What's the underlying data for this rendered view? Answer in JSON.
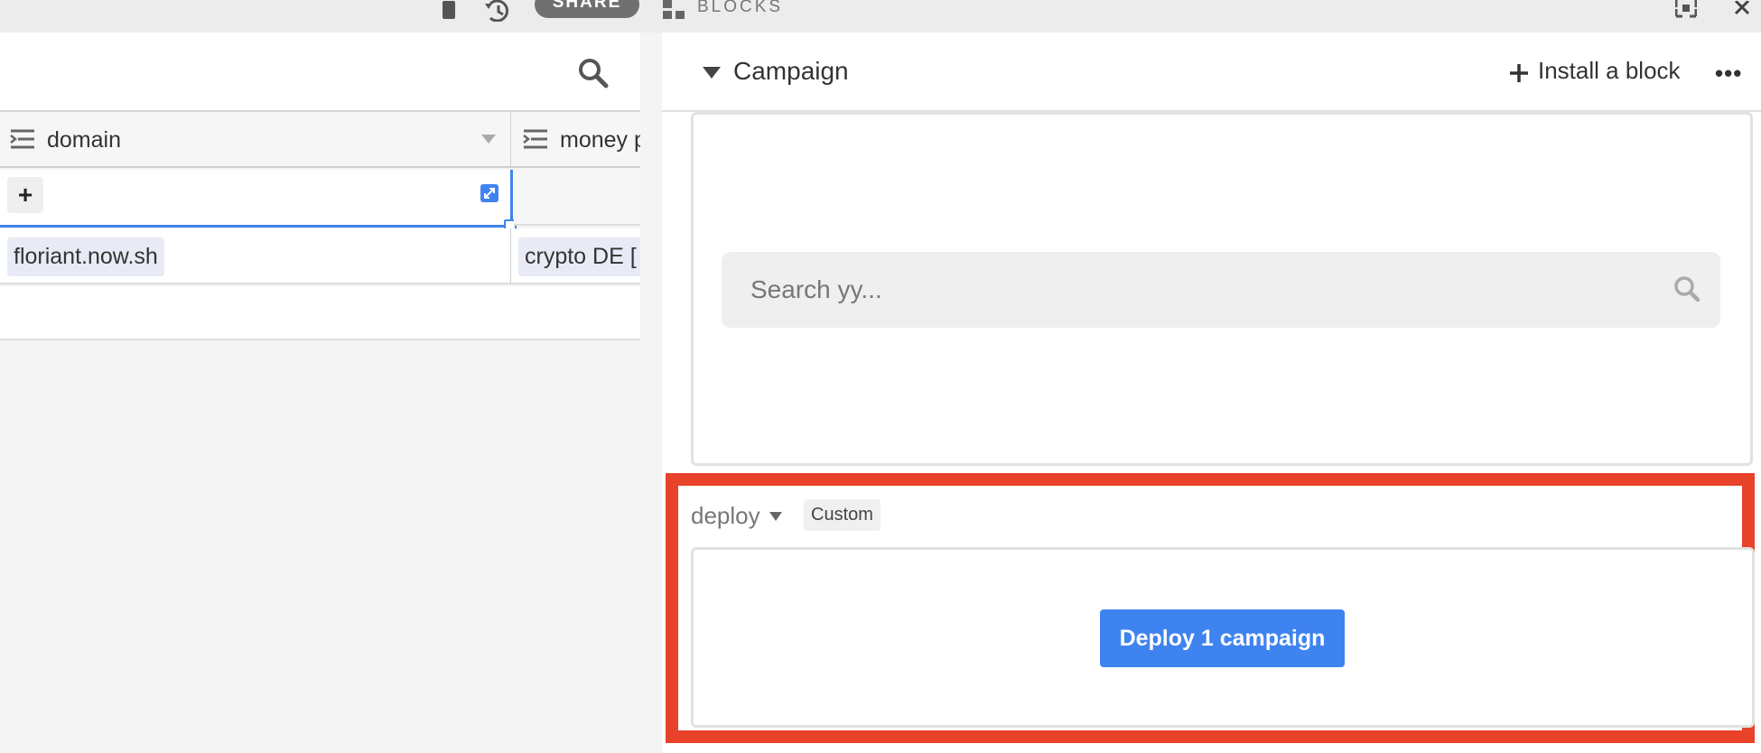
{
  "topbar": {
    "share_label": "SHARE",
    "blocks_title": "BLOCKS",
    "icons": [
      "phone-icon",
      "history-icon",
      "blocks-icon",
      "fullscreen-icon",
      "close-icon"
    ]
  },
  "grid": {
    "columns": [
      {
        "label": "domain",
        "icon": "long-text-icon"
      },
      {
        "label": "money p",
        "icon": "long-text-icon"
      }
    ],
    "rows": [
      {
        "cells": [
          "",
          ""
        ]
      },
      {
        "cells": [
          "floriant.now.sh",
          "crypto DE ["
        ]
      }
    ],
    "add_label": "+"
  },
  "panel": {
    "title": "Campaign",
    "install_label": "Install a block",
    "more_label": "•••",
    "search_placeholder": "Search yy...",
    "deploy": {
      "field_label": "deploy",
      "badge": "Custom",
      "button_label": "Deploy 1 campaign"
    }
  },
  "colors": {
    "accent": "#3f83f0",
    "highlight_frame": "#e8422a",
    "chip_bg": "#e8ebf5"
  }
}
